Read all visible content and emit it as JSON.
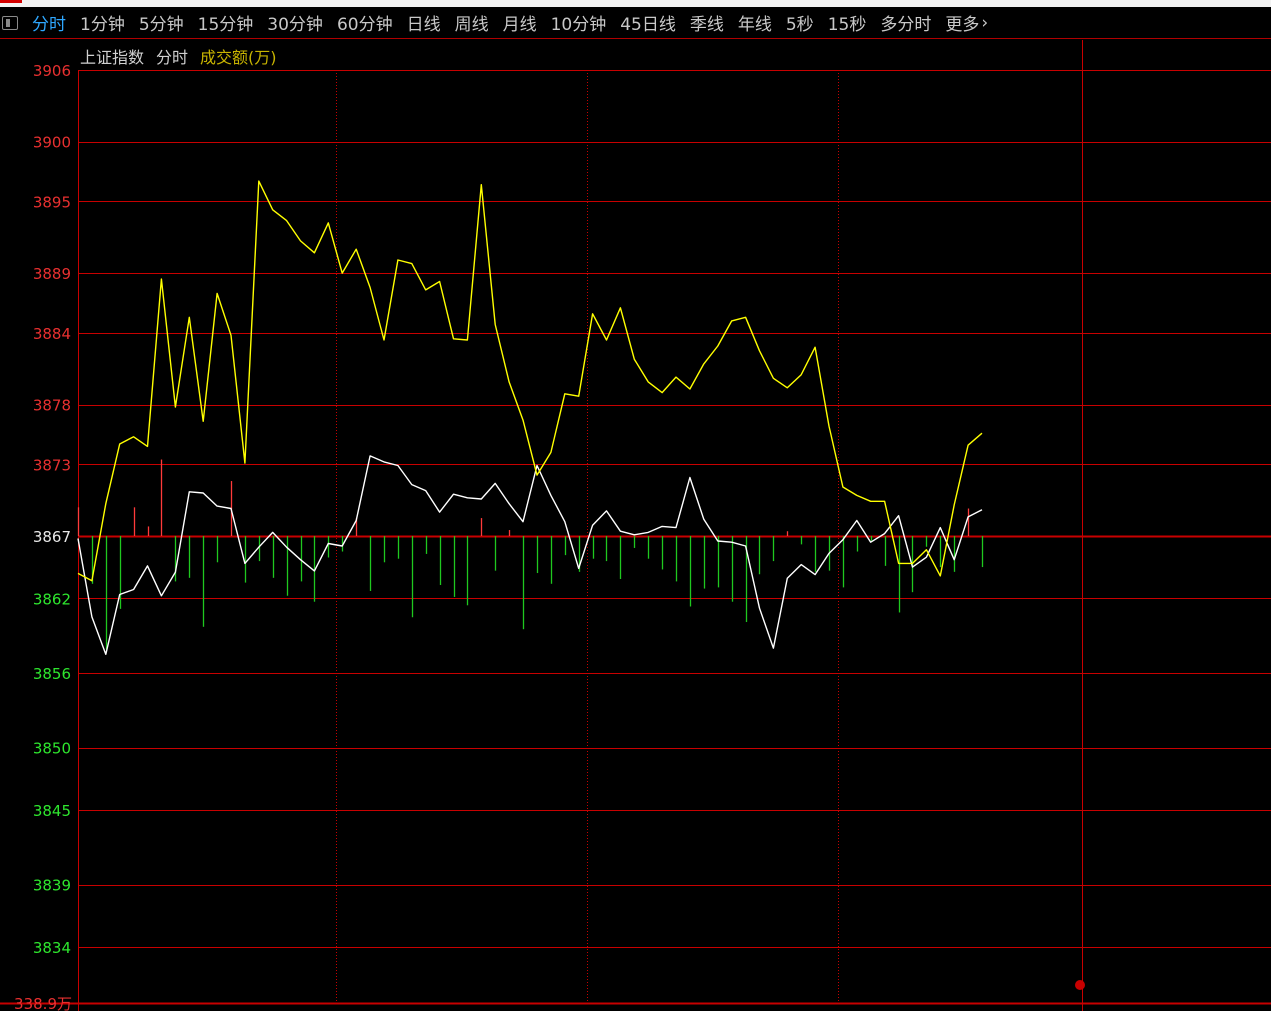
{
  "toolbar": {
    "tabs": [
      "分时",
      "1分钟",
      "5分钟",
      "15分钟",
      "30分钟",
      "60分钟",
      "日线",
      "周线",
      "月线",
      "10分钟",
      "45日线",
      "季线",
      "年线",
      "5秒",
      "15秒",
      "多分时"
    ],
    "active_tab": "分时",
    "more_label": "更多"
  },
  "legend": {
    "index_name": "上证指数",
    "mode": "分时",
    "volume_label": "成交额(万)"
  },
  "colors": {
    "background": "#000000",
    "grid": "#c80000",
    "up": "#ff3a3a",
    "down": "#1fc81f",
    "index_line": "#ffffff",
    "average_line": "#ffff00",
    "active_tab": "#2fa8ff"
  },
  "chart_data": {
    "type": "line",
    "y_ticks": [
      3906,
      3900,
      3895,
      3889,
      3884,
      3878,
      3873,
      3867,
      3862,
      3856,
      3850,
      3845,
      3839,
      3834
    ],
    "y_reference": 3867,
    "ylim": [
      3829.5,
      3906
    ],
    "bottom_label": "338.9万",
    "grid": true,
    "x_count": 66,
    "series": [
      {
        "name": "指数",
        "values": [
          3866.8,
          3860.5,
          3857.5,
          3862.3,
          3862.7,
          3864.6,
          3862.2,
          3864.1,
          3870.7,
          3870.6,
          3869.5,
          3869.3,
          3864.8,
          3866.1,
          3867.3,
          3866.1,
          3865.1,
          3864.2,
          3866.4,
          3866.2,
          3868.3,
          3873.7,
          3873.2,
          3872.9,
          3871.3,
          3870.8,
          3869.0,
          3870.5,
          3870.2,
          3870.1,
          3871.4,
          3869.7,
          3868.2,
          3872.9,
          3870.4,
          3868.2,
          3864.4,
          3867.9,
          3869.1,
          3867.4,
          3867.1,
          3867.3,
          3867.8,
          3867.7,
          3871.9,
          3868.4,
          3866.6,
          3866.5,
          3866.2,
          3861.2,
          3858.0,
          3863.6,
          3864.7,
          3863.9,
          3865.6,
          3866.7,
          3868.3,
          3866.5,
          3867.2,
          3868.7,
          3864.5,
          3865.3,
          3867.7,
          3865.1,
          3868.6,
          3869.2
        ]
      },
      {
        "name": "均价",
        "values": [
          3864.0,
          3863.4,
          3869.7,
          3874.7,
          3875.3,
          3874.5,
          3888.5,
          3877.8,
          3885.3,
          3876.6,
          3887.3,
          3883.8,
          3873.1,
          3896.7,
          3894.3,
          3893.4,
          3891.7,
          3890.7,
          3893.2,
          3889.0,
          3891.0,
          3887.8,
          3883.4,
          3890.1,
          3889.8,
          3887.6,
          3888.3,
          3883.5,
          3883.4,
          3896.4,
          3884.7,
          3879.9,
          3876.7,
          3872.1,
          3874.0,
          3878.9,
          3878.7,
          3885.6,
          3883.4,
          3886.1,
          3881.8,
          3879.9,
          3879.0,
          3880.3,
          3879.3,
          3881.4,
          3882.9,
          3885.0,
          3885.3,
          3882.5,
          3880.2,
          3879.4,
          3880.5,
          3882.8,
          3876.2,
          3871.1,
          3870.4,
          3869.9,
          3869.9,
          3864.8,
          3864.8,
          3865.9,
          3863.8,
          3869.6,
          3874.6,
          3875.6
        ]
      }
    ],
    "bars": [
      2.4,
      -4.0,
      -9.5,
      -6.1,
      2.4,
      0.8,
      6.4,
      -3.8,
      -3.5,
      -7.6,
      -2.2,
      4.6,
      -3.9,
      -2.1,
      -3.5,
      -5.0,
      -3.8,
      -5.5,
      -1.8,
      -1.3,
      1.5,
      -4.6,
      -2.2,
      -1.9,
      -6.8,
      -1.5,
      -4.1,
      -5.1,
      -5.8,
      1.5,
      -2.9,
      0.5,
      -7.8,
      -3.1,
      -4.0,
      -1.6,
      -3.0,
      -1.9,
      -2.1,
      -3.6,
      -1.0,
      -1.9,
      -2.8,
      -3.8,
      -5.9,
      -4.4,
      -4.3,
      -5.5,
      -7.2,
      -3.2,
      -2.1,
      0.4,
      -0.7,
      -3.0,
      -2.9,
      -4.3,
      -1.3,
      -0.4,
      -2.5,
      -6.4,
      -4.7,
      -0.9,
      -2.6,
      -3.0,
      2.3,
      -2.6
    ]
  }
}
